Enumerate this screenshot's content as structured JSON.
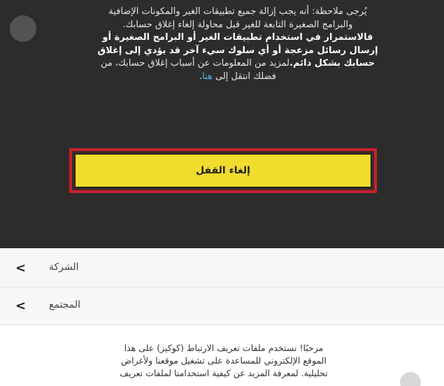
{
  "note": {
    "line1": "يُرجى ملاحظة: أنه يجب إزالة جميع تطبيقات الغير والمكونات الإضافية",
    "line2": "والبرامج الصغيرة التابعة للغير قبل محاولة إلغاء إغلاق حسابك.",
    "line3": "فالاستمرار في استخدام تطبيقات الغير أو البرامج الصغيرة أو",
    "line4": "إرسال رسائل مزعجة أو أي سلوك سيء آخر قد يؤدي إلى إغلاق",
    "line5_bold": "حسابك بشكل دائم.",
    "line5_rest": "لمزيد من المعلومات عن أسباب إغلاق حسابك، من",
    "line6_pre": "فضلك انتقل إلى ",
    "line6_link": "هنا",
    "line6_post": "."
  },
  "unlock_button_label": "إلغاء القفل",
  "menu": {
    "company": "الشركة",
    "community": "المجتمع"
  },
  "cookie_notice": {
    "line1": "مرحبًا! نستخدم ملفات تعريف الارتباط (كوكيز) على هذا",
    "line2": "الموقع الإلكتروني للمساعدة على تشغيل موقعنا ولأغراض",
    "line3": "تحليلية. لمعرفة المزيد عن كيفية استخدامنا لملفات تعريف"
  },
  "colors": {
    "panel": "#2c2c2c",
    "button_yellow": "#f0dc2c",
    "highlight_red": "#c8202a",
    "link_blue": "#5aaee8"
  }
}
